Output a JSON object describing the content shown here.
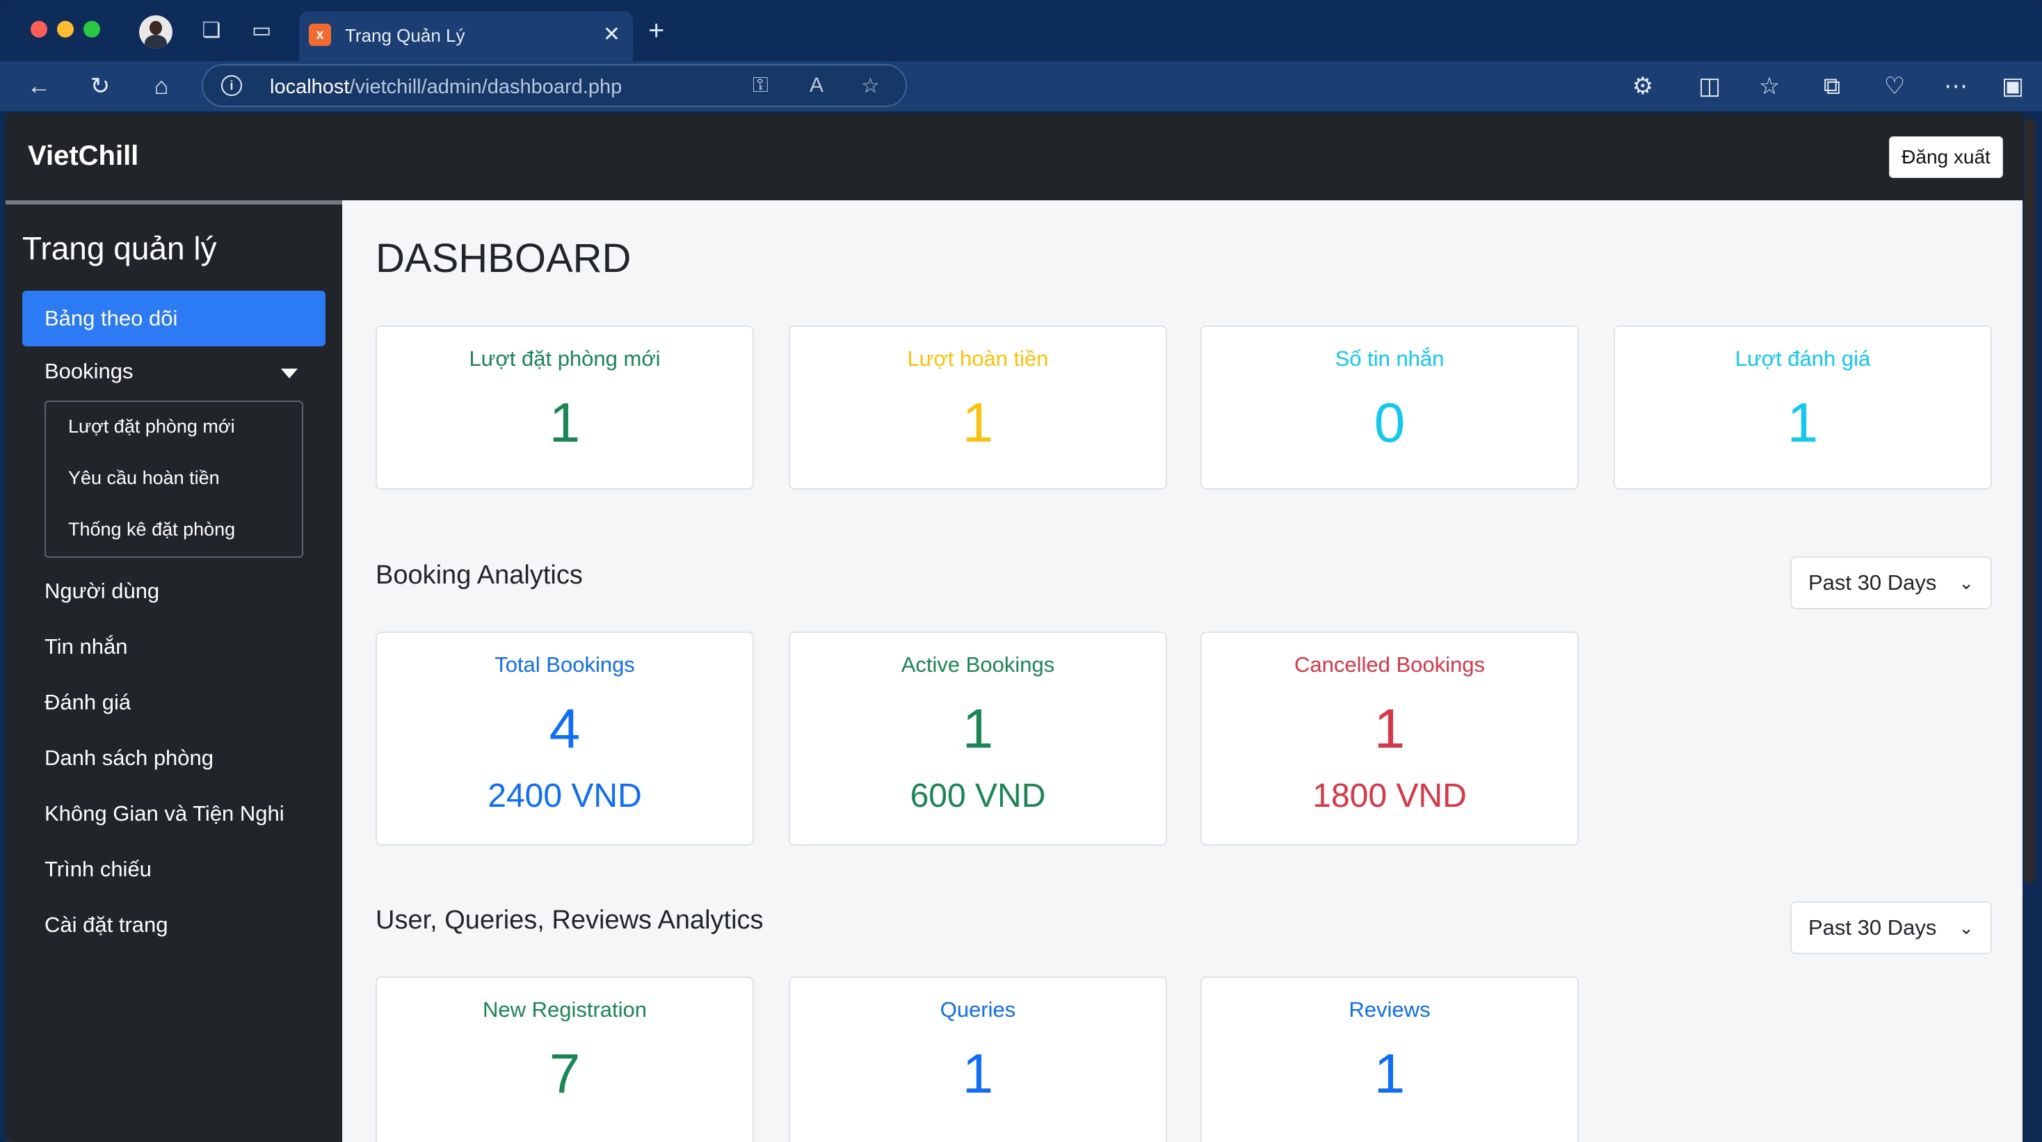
{
  "browser": {
    "tab_title": "Trang Quản Lý",
    "tab_favicon": "x",
    "url_host": "localhost",
    "url_path": "/vietchill/admin/dashboard.php"
  },
  "header": {
    "brand": "VietChill",
    "logout_label": "Đăng xuất"
  },
  "sidebar": {
    "title": "Trang quản lý",
    "active_item": "Bảng theo dõi",
    "bookings_label": "Bookings",
    "bookings_sub": [
      "Lượt đặt phòng mới",
      "Yêu cầu hoàn tiền",
      "Thống kê đặt phòng"
    ],
    "items": [
      "Người dùng",
      "Tin nhắn",
      "Đánh giá",
      "Danh sách phòng",
      "Không Gian và Tiện Nghi",
      "Trình chiếu",
      "Cài đặt trang"
    ]
  },
  "main": {
    "title": "DASHBOARD",
    "summary_cards": [
      {
        "label": "Lượt đặt phòng mới",
        "value": "1",
        "color": "#198754"
      },
      {
        "label": "Lượt hoàn tiền",
        "value": "1",
        "color": "#ffc107"
      },
      {
        "label": "Số tin nhắn",
        "value": "0",
        "color": "#0dcaf0"
      },
      {
        "label": "Lượt đánh giá",
        "value": "1",
        "color": "#0dcaf0"
      }
    ],
    "booking_analytics": {
      "title": "Booking Analytics",
      "period": "Past 30 Days",
      "cards": [
        {
          "label": "Total Bookings",
          "value": "4",
          "amount": "2400 VND",
          "color": "#0d6efd"
        },
        {
          "label": "Active Bookings",
          "value": "1",
          "amount": "600 VND",
          "color": "#198754"
        },
        {
          "label": "Cancelled Bookings",
          "value": "1",
          "amount": "1800 VND",
          "color": "#dc3545"
        }
      ]
    },
    "user_analytics": {
      "title": "User, Queries, Reviews Analytics",
      "period": "Past 30 Days",
      "cards": [
        {
          "label": "New Registration",
          "value": "7",
          "color": "#198754"
        },
        {
          "label": "Queries",
          "value": "1",
          "color": "#0d6efd"
        },
        {
          "label": "Reviews",
          "value": "1",
          "color": "#0d6efd"
        }
      ]
    }
  }
}
